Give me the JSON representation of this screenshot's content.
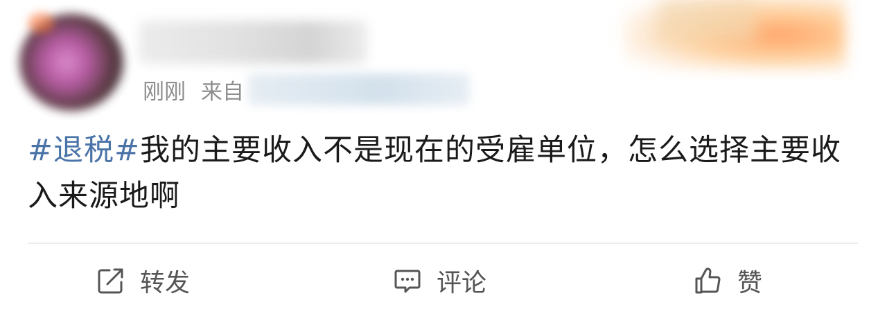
{
  "author": {
    "avatar_icon": "avatar-icon",
    "name": ""
  },
  "meta": {
    "time": "刚刚",
    "source_prefix": "来自"
  },
  "post": {
    "hashtag": "#退税#",
    "text": "我的主要收入不是现在的受雇单位，怎么选择主要收入来源地啊"
  },
  "actions": {
    "repost_label": "转发",
    "repost_icon": "share-icon",
    "comment_label": "评论",
    "comment_icon": "comment-icon",
    "like_label": "赞",
    "like_icon": "thumbs-up-icon"
  },
  "colors": {
    "hashtag": "#4a73a8",
    "text": "#1a1a1a",
    "meta": "#8d8d8d",
    "action": "#555555",
    "divider": "#ececec"
  }
}
